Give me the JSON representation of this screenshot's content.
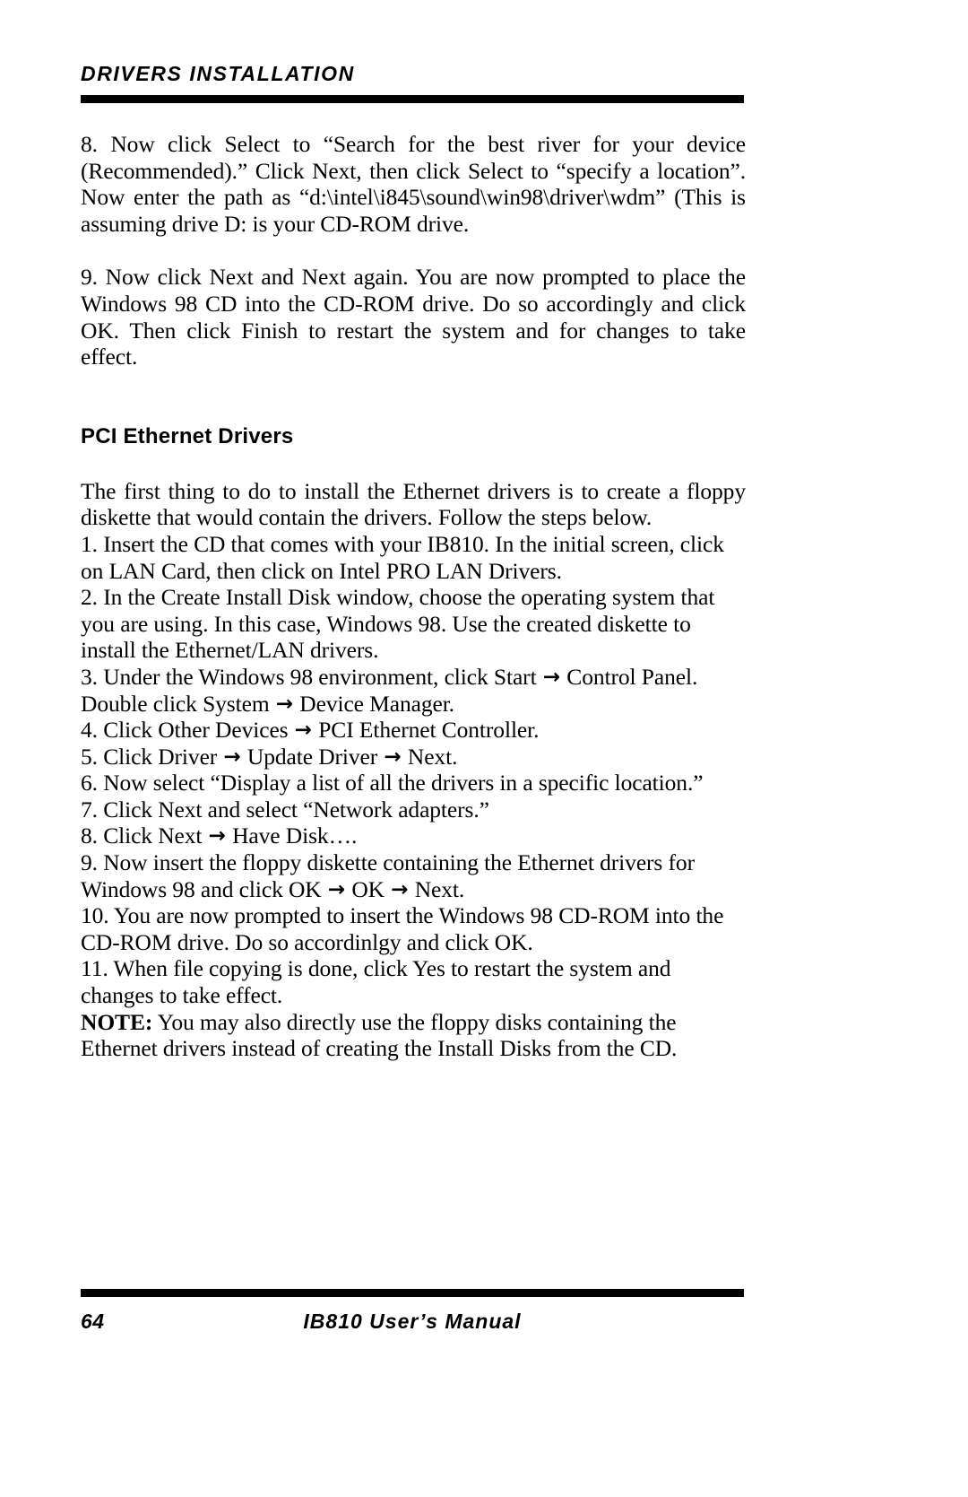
{
  "header": {
    "running_title": "DRIVERS INSTALLATION"
  },
  "body": {
    "paragraph_8": "8. Now click Select to “Search for the best river for your device (Recommended).” Click Next, then click Select to “specify a location”. Now enter the path as “d:\\intel\\i845\\sound\\win98\\driver\\wdm” (This is assuming drive D: is your CD-ROM drive.",
    "paragraph_9": "9. Now click Next and Next again. You are now prompted to place the Windows 98 CD into the CD-ROM drive. Do so accordingly and click OK. Then click Finish to restart the system and for changes to take effect.",
    "section_heading": "PCI Ethernet Drivers",
    "intro_paragraph": "The first thing to do to install the Ethernet drivers is to create a floppy diskette that would contain the drivers. Follow the steps below.",
    "steps": [
      {
        "id": "step-1",
        "parts": [
          "1. Insert the CD that comes with your IB810. In the initial screen, click on LAN Card, then click on Intel PRO LAN Drivers."
        ]
      },
      {
        "id": "step-2",
        "parts": [
          "2. In the Create Install Disk window, choose the operating system that you are using. In this case, Windows 98. Use the created diskette to install the Ethernet/LAN drivers."
        ]
      },
      {
        "id": "step-3",
        "parts": [
          "3. Under the Windows 98 environment, click Start ",
          "→",
          " Control Panel. Double click System ",
          "→",
          " Device Manager."
        ]
      },
      {
        "id": "step-4",
        "parts": [
          "4. Click Other Devices ",
          "→",
          " PCI Ethernet Controller."
        ]
      },
      {
        "id": "step-5",
        "parts": [
          "5. Click Driver ",
          "→",
          " Update Driver  ",
          "→",
          " Next."
        ]
      },
      {
        "id": "step-6",
        "parts": [
          "6. Now select “Display a list of all the drivers in a specific location.”"
        ]
      },
      {
        "id": "step-7",
        "parts": [
          "7. Click Next and select “Network adapters.”"
        ]
      },
      {
        "id": "step-8",
        "parts": [
          "8. Click Next ",
          "→",
          " Have Disk…."
        ]
      },
      {
        "id": "step-9",
        "parts": [
          "9. Now insert the floppy diskette containing the Ethernet drivers for Windows 98 and click OK ",
          "→",
          " OK ",
          "→",
          " Next."
        ]
      },
      {
        "id": "step-10",
        "parts": [
          "10. You are now prompted to insert the Windows 98 CD-ROM into the CD-ROM drive. Do so accordinlgy and click OK."
        ]
      },
      {
        "id": "step-11",
        "parts": [
          "11. When file copying is done, click Yes to restart the system and changes to take effect."
        ]
      }
    ],
    "note_label": "NOTE:",
    "note_text": " You may also directly use the floppy disks containing the Ethernet drivers instead of creating the Install Disks from the CD."
  },
  "footer": {
    "page_number": "64",
    "manual_title": "IB810 User’s Manual"
  },
  "colors": {
    "rule": "#000000",
    "text": "#000000",
    "page_background": "#ffffff"
  }
}
